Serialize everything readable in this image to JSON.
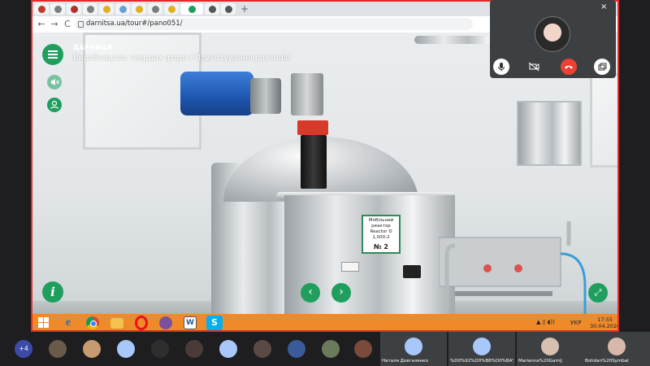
{
  "browser": {
    "url": "darnitsa.ua/tour#/pano051/",
    "new_tab_glyph": "+",
    "back_glyph": "←",
    "forward_glyph": "→",
    "reload_glyph": "C",
    "tab_colors": [
      "#c0392b",
      "#7d7d7d",
      "#b03030",
      "#7d7d7d",
      "#e0b020",
      "#6aa0d0",
      "#e0b020",
      "#7d7d7d",
      "#e0b020",
      "#1f9e5e",
      "#555555",
      "#555555"
    ]
  },
  "tour": {
    "brand": "ДАРНИЦЯ",
    "title": "Виробництво твердих форм / Приготування розчинів",
    "info_glyph": "i",
    "prev_glyph": "‹",
    "next_glyph": "›",
    "expand_glyph": "⤢",
    "equipment_label": {
      "line1": "Мобільний",
      "line2": "реактор",
      "line3": "Reactor D 1,000-2",
      "number": "№ 2"
    },
    "colors": {
      "accent": "#1f9e5e",
      "motor_blue": "#2563c4",
      "collar_red": "#d83a2a"
    }
  },
  "taskbar": {
    "color": "#ef8a2a",
    "language": "УКР",
    "time": "17:55",
    "date": "30.04.2020",
    "word_glyph": "W",
    "skype_glyph": "S",
    "ie_glyph": "e"
  },
  "call": {
    "self_close_glyph": "×",
    "controls": [
      "mic-icon",
      "camera-off-icon",
      "hangup-icon",
      "present-icon"
    ],
    "hidden_participants": "+4",
    "participants": [
      {
        "name": "Наталя Довгаленко"
      },
      {
        "name": "%D0%92%D0%B8%D0%BA%D0%B..."
      },
      {
        "name": "Marianna%20Gamij"
      },
      {
        "name": "Bohdan%20Symbal"
      }
    ]
  }
}
